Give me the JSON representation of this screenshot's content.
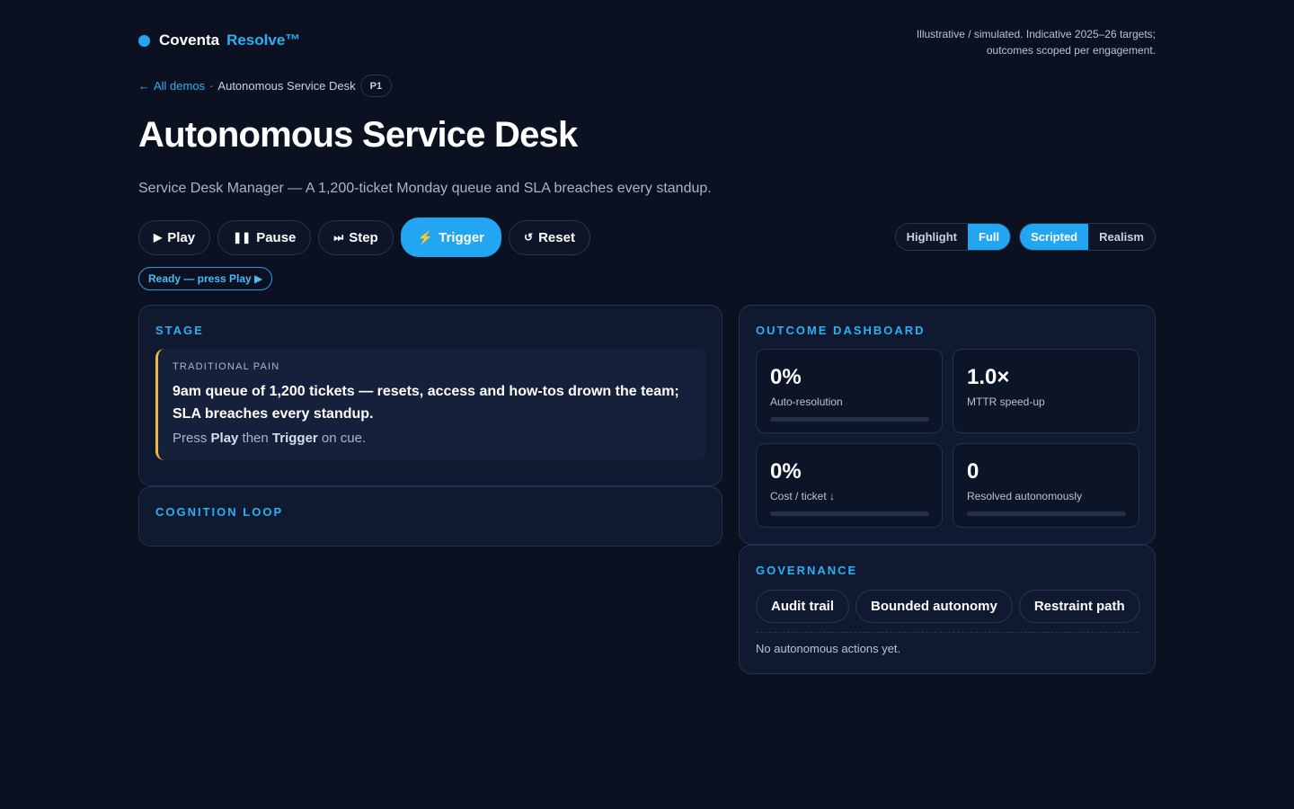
{
  "brand": {
    "name": "Coventa",
    "product": "Resolve™"
  },
  "disclaimer": "Illustrative / simulated. Indicative 2025–26 targets; outcomes scoped per engagement.",
  "breadcrumb": {
    "back_label": "All demos",
    "separator": "·",
    "current": "Autonomous Service Desk",
    "badge": "P1"
  },
  "page": {
    "title": "Autonomous Service Desk",
    "subtitle": "Service Desk Manager — A 1,200-ticket Monday queue and SLA breaches every standup."
  },
  "controls": {
    "play": "Play",
    "pause": "Pause",
    "step": "Step",
    "trigger": "Trigger",
    "reset": "Reset"
  },
  "toggles": {
    "view": {
      "options": [
        "Highlight",
        "Full"
      ],
      "selected": "Full"
    },
    "mode": {
      "options": [
        "Scripted",
        "Realism"
      ],
      "selected": "Scripted"
    }
  },
  "status": "Ready — press Play ▶",
  "stage": {
    "title": "STAGE",
    "card": {
      "label": "TRADITIONAL PAIN",
      "headline": "9am queue of 1,200 tickets — resets, access and how-tos drown the team; SLA breaches every standup.",
      "hint_prefix": "Press ",
      "hint_play": "Play",
      "hint_mid": " then ",
      "hint_trigger": "Trigger",
      "hint_suffix": " on cue."
    }
  },
  "cognition": {
    "title": "COGNITION LOOP"
  },
  "outcome": {
    "title": "OUTCOME DASHBOARD",
    "metrics": [
      {
        "value": "0%",
        "label": "Auto-resolution",
        "progress": 0,
        "has_bar": true
      },
      {
        "value": "1.0×",
        "label": "MTTR speed-up",
        "has_bar": false
      },
      {
        "value": "0%",
        "label": "Cost / ticket ↓",
        "progress": 0,
        "has_bar": true
      },
      {
        "value": "0",
        "label": "Resolved autonomously",
        "progress": 0,
        "has_bar": true
      }
    ]
  },
  "governance": {
    "title": "GOVERNANCE",
    "chips": [
      "Audit trail",
      "Bounded autonomy",
      "Restraint path"
    ],
    "empty_text": "No autonomous actions yet."
  },
  "colors": {
    "accent": "#22a6f2",
    "warning": "#f2b83a",
    "background": "#0b1120",
    "panel": "#0f1a31"
  }
}
